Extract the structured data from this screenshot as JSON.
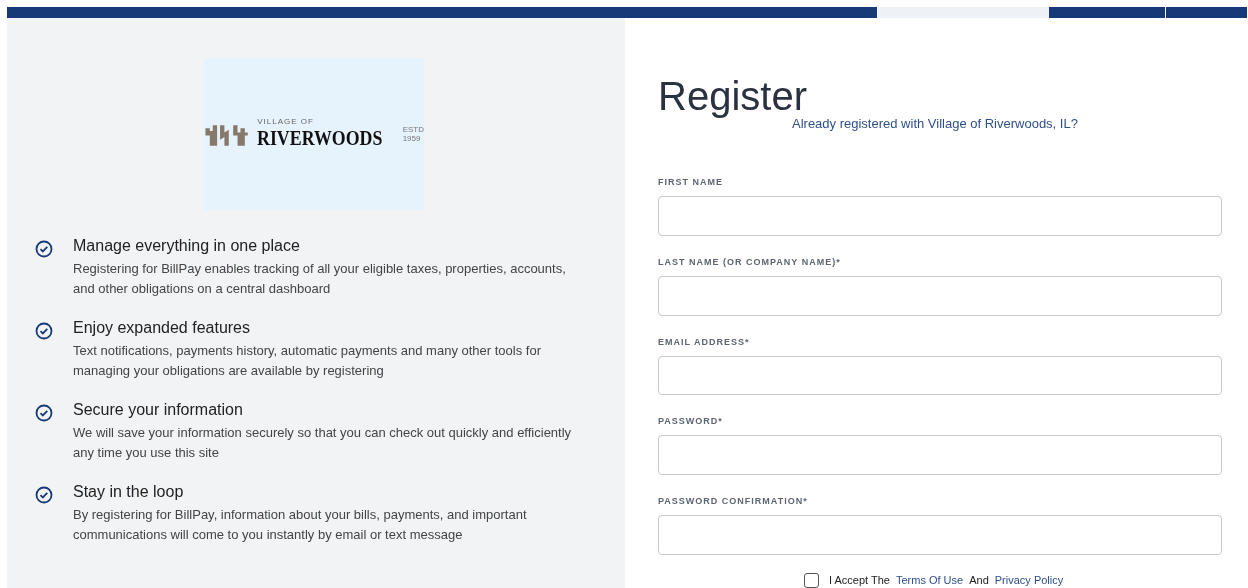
{
  "top_bar": {
    "segments": [
      {
        "kind": "dark"
      },
      {
        "kind": "light"
      },
      {
        "kind": "dark"
      },
      {
        "kind": "dark"
      }
    ]
  },
  "logo": {
    "overline": "VILLAGE OF",
    "name": "RIVERWOODS",
    "established": [
      "ESTD",
      "1959"
    ]
  },
  "benefits": [
    {
      "title": "Manage everything in one place",
      "text": "Registering for BillPay enables tracking of all your eligible taxes, properties, accounts, and other obligations on a central dashboard"
    },
    {
      "title": "Enjoy expanded features",
      "text": "Text notifications, payments history, automatic payments and many other tools for managing your obligations are available by registering"
    },
    {
      "title": "Secure your information",
      "text": "We will save your information securely so that you can check out quickly and efficiently any time you use this site"
    },
    {
      "title": "Stay in the loop",
      "text": "By registering for BillPay, information about your bills, payments, and important communications will come to you instantly by email or text message"
    }
  ],
  "form": {
    "title": "Register",
    "login_link": "Already registered with Village of Riverwoods, IL?",
    "fields": [
      {
        "label": "FIRST NAME"
      },
      {
        "label": "LAST NAME (OR COMPANY NAME)*"
      },
      {
        "label": "EMAIL ADDRESS*"
      },
      {
        "label": "PASSWORD*"
      },
      {
        "label": "PASSWORD CONFIRMATION*"
      }
    ],
    "terms": {
      "checked": false,
      "parts": [
        {
          "kind": "text",
          "text": "I Accept The"
        },
        {
          "kind": "link",
          "text": "Terms Of Use"
        },
        {
          "kind": "text",
          "text": "And"
        },
        {
          "kind": "link",
          "text": "Privacy Policy"
        }
      ]
    }
  }
}
